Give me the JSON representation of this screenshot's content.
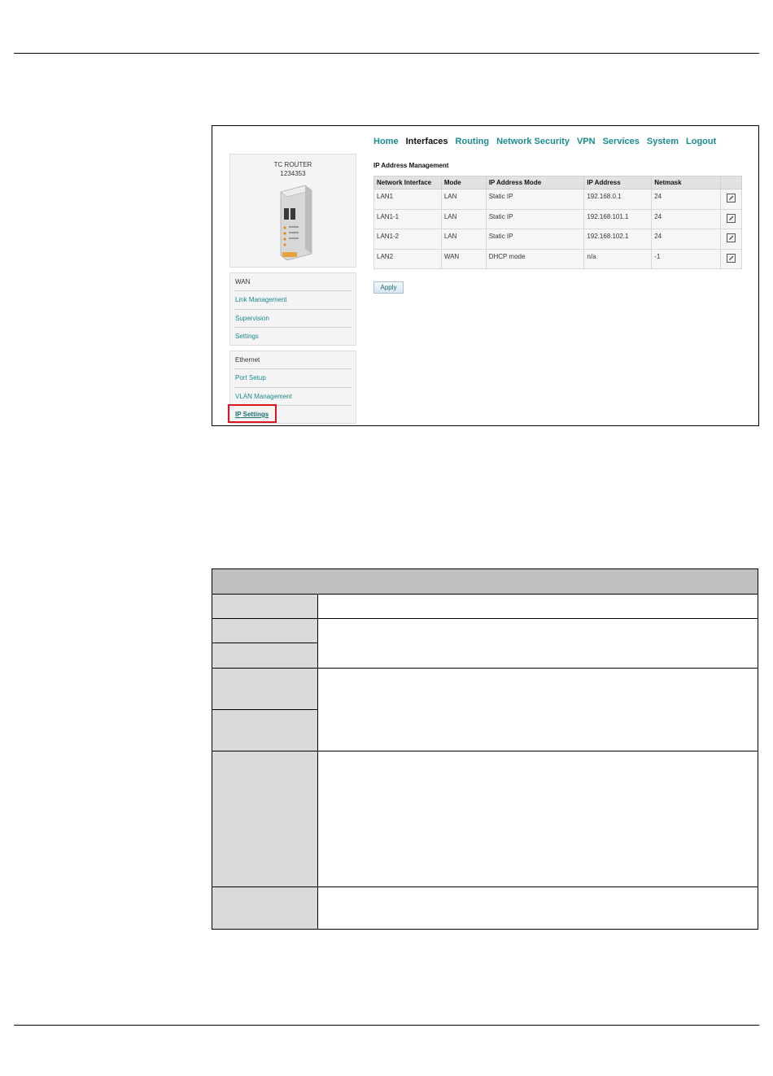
{
  "device": {
    "name": "TC ROUTER",
    "serial": "1234353"
  },
  "sidebar": {
    "wan": {
      "heading": "WAN",
      "items": [
        "Link Management",
        "Supervision",
        "Settings"
      ]
    },
    "ethernet": {
      "heading": "Ethernet",
      "items": [
        "Port Setup",
        "VLAN Management",
        "IP Settings"
      ],
      "active": "IP Settings"
    }
  },
  "topnav": {
    "items": [
      "Home",
      "Interfaces",
      "Routing",
      "Network Security",
      "VPN",
      "Services",
      "System",
      "Logout"
    ],
    "current": "Interfaces"
  },
  "main": {
    "title": "IP Address Management",
    "columns": [
      "Network Interface",
      "Mode",
      "IP Address Mode",
      "IP Address",
      "Netmask"
    ],
    "rows": [
      [
        "LAN1",
        "LAN",
        "Static IP",
        "192.168.0.1",
        "24"
      ],
      [
        "LAN1-1",
        "LAN",
        "Static IP",
        "192.168.101.1",
        "24"
      ],
      [
        "LAN1-2",
        "LAN",
        "Static IP",
        "192.168.102.1",
        "24"
      ],
      [
        "LAN2",
        "WAN",
        "DHCP mode",
        "n/a",
        "-1"
      ]
    ],
    "apply_label": "Apply"
  },
  "colors": {
    "link": "#1a8b8e",
    "highlight": "#e0141e",
    "table_header": "#c0c0c0",
    "table_label": "#d9d9d9"
  }
}
